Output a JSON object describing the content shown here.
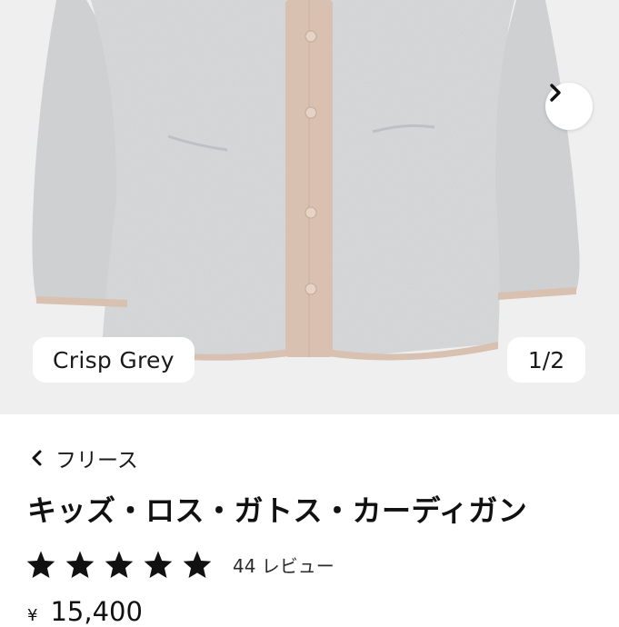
{
  "gallery": {
    "color_label": "Crisp Grey",
    "counter": "1/2",
    "next_icon": "chevron-right-icon",
    "background": "#efefef"
  },
  "product": {
    "breadcrumb": "フリース",
    "title": "キッズ・ロス・ガトス・カーディガン",
    "rating": {
      "stars": 5,
      "max_stars": 5,
      "review_label": "44 レビュー"
    },
    "price": {
      "currency": "¥",
      "amount": "15,400"
    }
  },
  "colors": {
    "fleece": "#d7d8da",
    "trim": "#d8c1b1",
    "text": "#1a1a1a"
  }
}
